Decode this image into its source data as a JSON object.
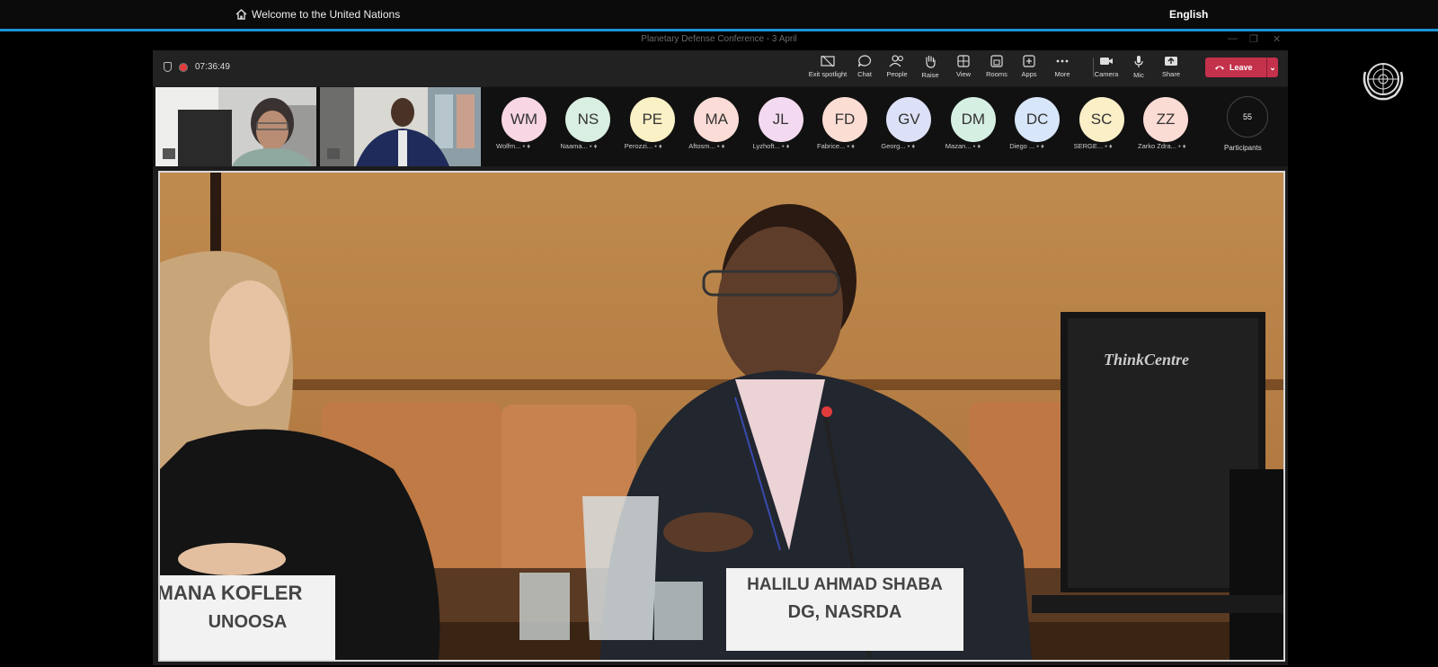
{
  "top_bar": {
    "welcome_text": "Welcome to the United Nations",
    "language": "English",
    "home_icon": "home-icon"
  },
  "window": {
    "title": "Planetary Defense Conference - 3 April",
    "controls": [
      "minimize-icon",
      "restore-icon",
      "close-icon"
    ]
  },
  "meeting": {
    "elapsed_time": "07:36:49",
    "toolbar": {
      "exit_spotlight": "Exit spotlight",
      "chat": "Chat",
      "people": "People",
      "raise": "Raise",
      "view": "View",
      "rooms": "Rooms",
      "apps": "Apps",
      "more": "More",
      "camera": "Camera",
      "mic": "Mic",
      "share": "Share",
      "leave": "Leave"
    },
    "participants": [
      {
        "initials": "WM",
        "name": "Wolfm...",
        "color": "#f9d6e4"
      },
      {
        "initials": "NS",
        "name": "Naama...",
        "color": "#d9efe2"
      },
      {
        "initials": "PE",
        "name": "Perozzi...",
        "color": "#fbf1c6"
      },
      {
        "initials": "MA",
        "name": "Aftosm...",
        "color": "#fbdcd6"
      },
      {
        "initials": "JL",
        "name": "Lyzhoft...",
        "color": "#f4daf0"
      },
      {
        "initials": "FD",
        "name": "Fabrice...",
        "color": "#fbddd3"
      },
      {
        "initials": "GV",
        "name": "Georg...",
        "color": "#dde1f7"
      },
      {
        "initials": "DM",
        "name": "Mazan...",
        "color": "#d6efe3"
      },
      {
        "initials": "DC",
        "name": "Diego ...",
        "color": "#d7e6f8"
      },
      {
        "initials": "SC",
        "name": "SERGE...",
        "color": "#fbefc8"
      },
      {
        "initials": "ZZ",
        "name": "Zarko Zdra...",
        "color": "#fbdcd4"
      }
    ],
    "participant_count": "55",
    "participants_label": "Participants"
  },
  "stage": {
    "nameplate_left_line1": "MANA KOFLER",
    "nameplate_left_line2": "UNOOSA",
    "nameplate_right_line1": "HALILU AHMAD SHABA",
    "nameplate_right_line2": "DG, NASRDA",
    "monitor_brand": "ThinkCentre"
  },
  "colors": {
    "leave": "#c4314b",
    "accent_line": "#1a94d4",
    "wall": "#b8834a"
  }
}
